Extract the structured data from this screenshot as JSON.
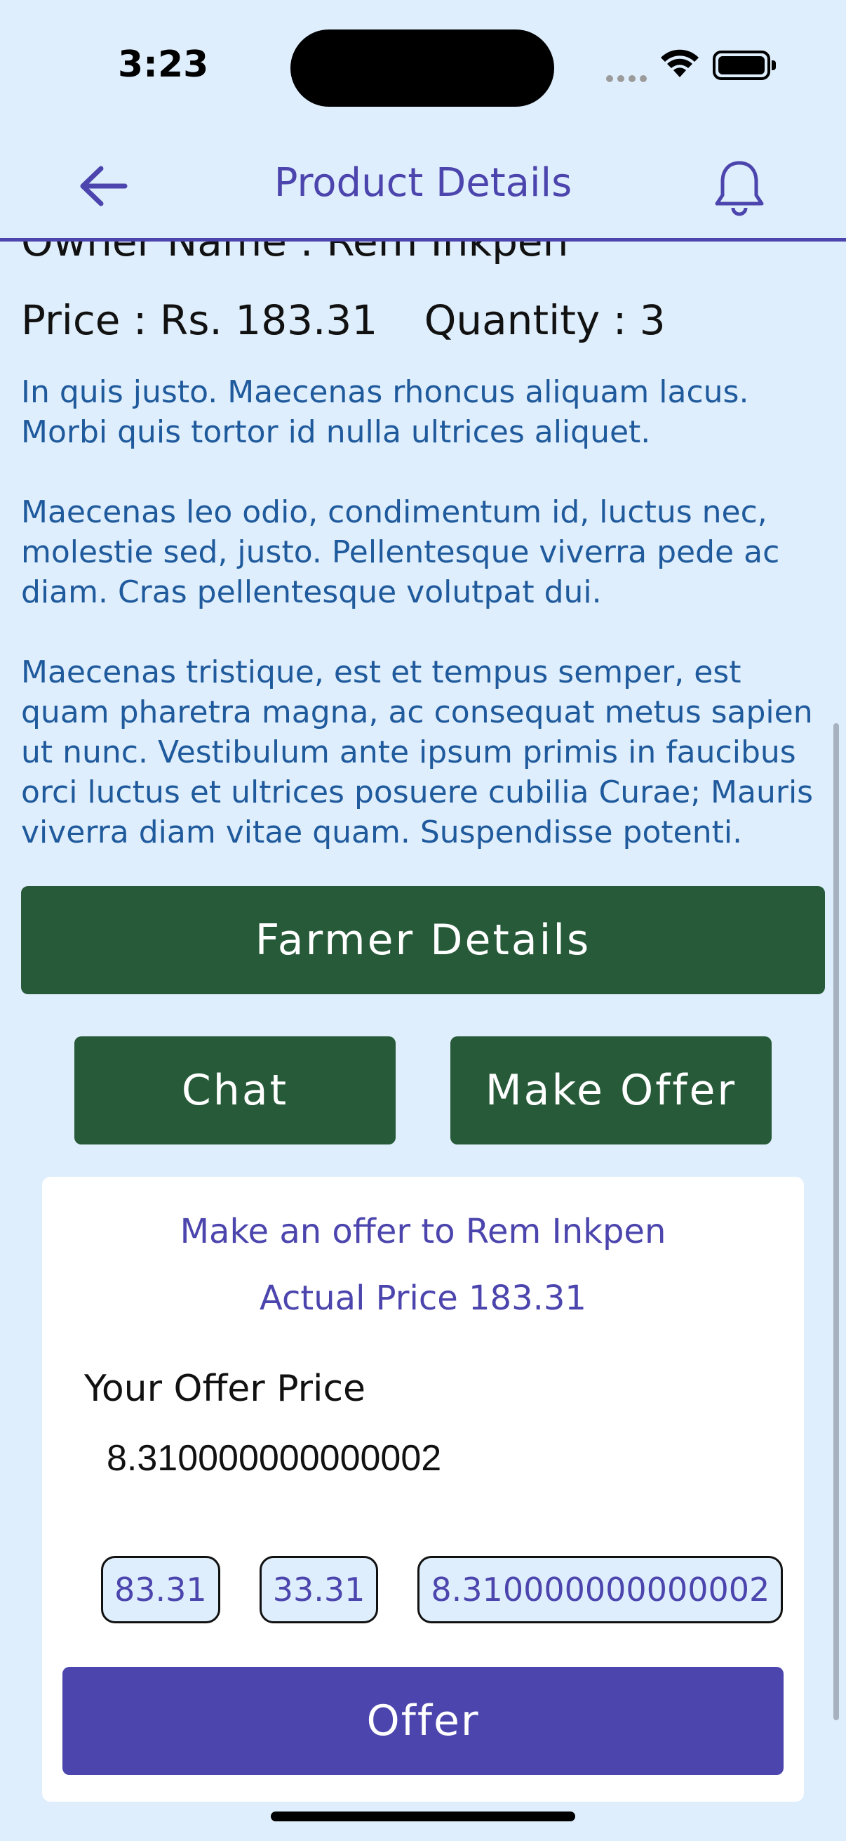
{
  "status_bar": {
    "time": "3:23"
  },
  "header": {
    "title": "Product Details"
  },
  "product": {
    "owner_line": "Owner Name : Rem Inkpen",
    "price_text": "Price : Rs. 183.31",
    "quantity_text": "Quantity : 3",
    "description": [
      "In quis justo. Maecenas rhoncus aliquam lacus. Morbi quis tortor id nulla ultrices aliquet.",
      "Maecenas leo odio, condimentum id, luctus nec, molestie sed, justo. Pellentesque viverra pede ac diam. Cras pellentesque volutpat dui.",
      "Maecenas tristique, est et tempus semper, est quam pharetra magna, ac consequat metus sapien ut nunc. Vestibulum ante ipsum primis in faucibus orci luctus et ultrices posuere cubilia Curae; Mauris viverra diam vitae quam. Suspendisse potenti."
    ]
  },
  "actions": {
    "farmer_details": "Farmer Details",
    "chat": "Chat",
    "make_offer": "Make Offer"
  },
  "offer_card": {
    "title": "Make an offer to Rem Inkpen",
    "actual_price": "Actual Price 183.31",
    "label": "Your Offer Price",
    "input_value": "8.310000000000002",
    "suggestions": [
      "83.31",
      "33.31",
      "8.310000000000002"
    ],
    "submit_label": "Offer"
  },
  "colors": {
    "background": "#dfeefc",
    "accent": "#4b45ad",
    "green": "#265a38",
    "description_text": "#1f5a9c"
  },
  "icons": [
    "back-arrow-icon",
    "bell-icon",
    "wifi-icon",
    "battery-icon"
  ]
}
